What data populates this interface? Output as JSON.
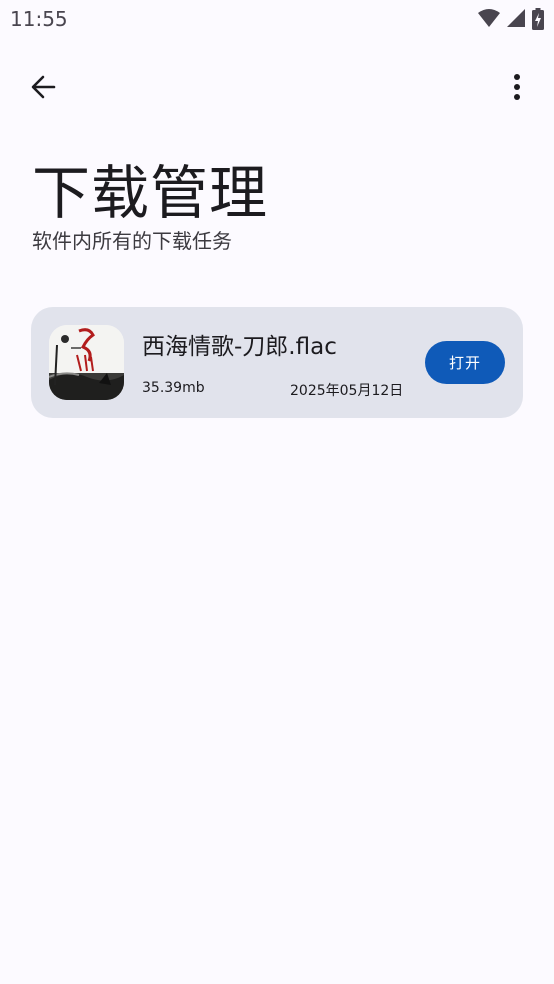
{
  "status_bar": {
    "time": "11:55",
    "icons": [
      "wifi-icon",
      "signal-icon",
      "battery-charging-icon"
    ]
  },
  "top_bar": {
    "back_icon": "arrow-back-icon",
    "more_icon": "more-vert-icon"
  },
  "page": {
    "title": "下载管理",
    "subtitle": "软件内所有的下载任务"
  },
  "downloads": [
    {
      "file_name": "西海情歌-刀郎.flac",
      "size": "35.39mb",
      "date": "2025年05月12日",
      "action_label": "打开",
      "art": "album-art-image"
    }
  ],
  "colors": {
    "background": "#fcfaff",
    "card": "#e1e3ec",
    "accent": "#0f5ab8",
    "text": "#1c1b1f"
  }
}
